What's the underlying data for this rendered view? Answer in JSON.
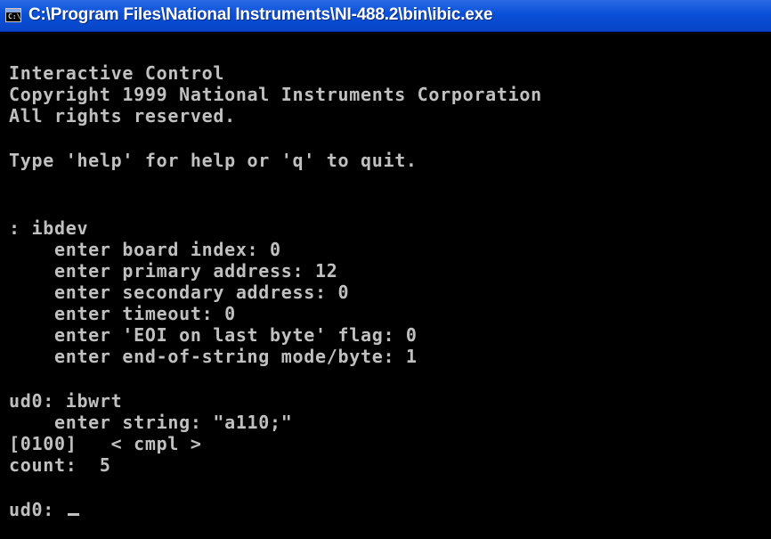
{
  "window": {
    "title": "C:\\Program Files\\National Instruments\\NI-488.2\\bin\\ibic.exe",
    "icon": "console-window-icon",
    "text_color": "#c0c0c0",
    "background": "#000000",
    "titlebar_color": "#0a50d8"
  },
  "console": {
    "banner": [
      "Interactive Control",
      "Copyright 1999 National Instruments Corporation",
      "All rights reserved."
    ],
    "help_hint": "Type 'help' for help or 'q' to quit.",
    "ibdev_command": ": ibdev",
    "ibdev_prompts": [
      "    enter board index: 0",
      "    enter primary address: 12",
      "    enter secondary address: 0",
      "    enter timeout: 0",
      "    enter 'EOI on last byte' flag: 0",
      "    enter end-of-string mode/byte: 1"
    ],
    "ibwrt_command": "ud0: ibwrt",
    "ibwrt_prompt": "    enter string: \"a110;\"",
    "status_line": "[0100]   < cmpl >",
    "count_line": "count:  5",
    "current_prompt": "ud0: "
  }
}
